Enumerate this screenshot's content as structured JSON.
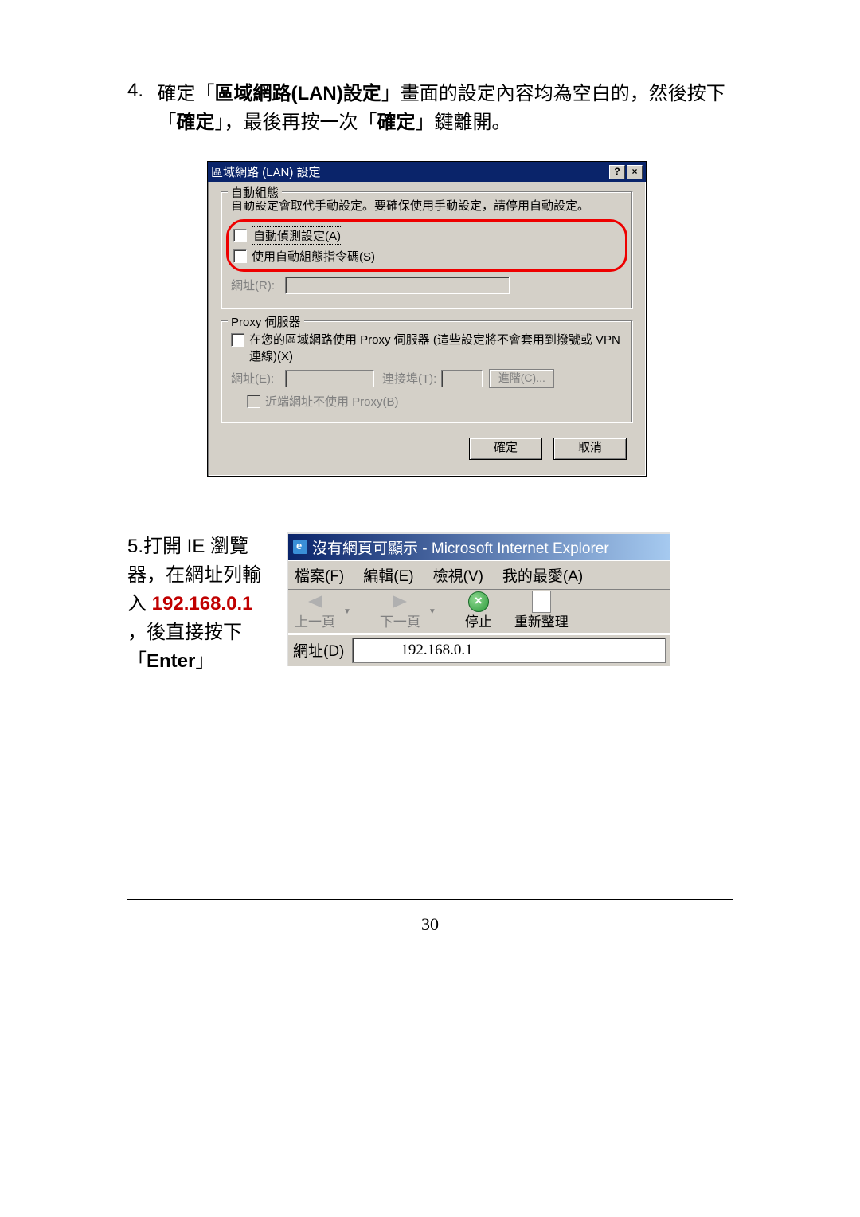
{
  "step4": {
    "num": "4.",
    "text_before": "確定「",
    "text_bold": "區域網路(LAN)設定",
    "text_mid": "」畫面的設定內容均為空白的，然後按下「",
    "text_bold2": "確定",
    "text_mid2": "」，最後再按一次「",
    "text_bold3": "確定",
    "text_after": "」鍵離開。"
  },
  "dialog": {
    "title": "區域網路 (LAN) 設定",
    "group_auto": {
      "legend": "自動組態",
      "desc": "自動設定會取代手動設定。要確保使用手動設定，請停用自動設定。",
      "cb_auto_detect": "自動偵測設定(A)",
      "cb_auto_script": "使用自動組態指令碼(S)",
      "addr_label": "網址(R):"
    },
    "group_proxy": {
      "legend": "Proxy 伺服器",
      "cb_use_proxy": "在您的區域網路使用 Proxy 伺服器 (這些設定將不會套用到撥號或 VPN 連線)(X)",
      "addr_label": "網址(E):",
      "port_label": "連接埠(T):",
      "advanced_btn": "進階(C)...",
      "cb_bypass": "近端網址不使用 Proxy(B)"
    },
    "ok_btn": "確定",
    "cancel_btn": "取消"
  },
  "step5": {
    "text1": "5.打開 IE 瀏覽器，在網址列輸入",
    "ip": "192.168.0.1",
    "text2": "，後直接按下「",
    "enter_bold": "Enter",
    "text3": "」"
  },
  "ie": {
    "title": "沒有網頁可顯示 - Microsoft Internet Explorer",
    "menuFile": "檔案(F)",
    "menuEdit": "編輯(E)",
    "menuView": "檢視(V)",
    "menuFav": "我的最愛(A)",
    "tbBack": "上一頁",
    "tbFwd": "下一頁",
    "tbStop": "停止",
    "tbRefresh": "重新整理",
    "addrLabel": "網址(D)",
    "addrValue": "192.168.0.1"
  },
  "page_number": "30"
}
